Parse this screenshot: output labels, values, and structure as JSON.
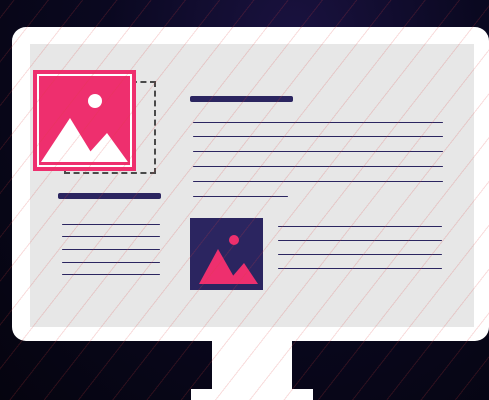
{
  "illustration": {
    "subject": "desktop-monitor-document-layout",
    "colors": {
      "monitor": "#ffffff",
      "screen": "#e7e7e7",
      "accent_pink": "#ee2f6e",
      "navy": "#2b2560",
      "text_line": "#2b2560",
      "background": "#0a0820"
    },
    "icons": [
      "image-placeholder-icon",
      "image-placeholder-icon"
    ]
  }
}
